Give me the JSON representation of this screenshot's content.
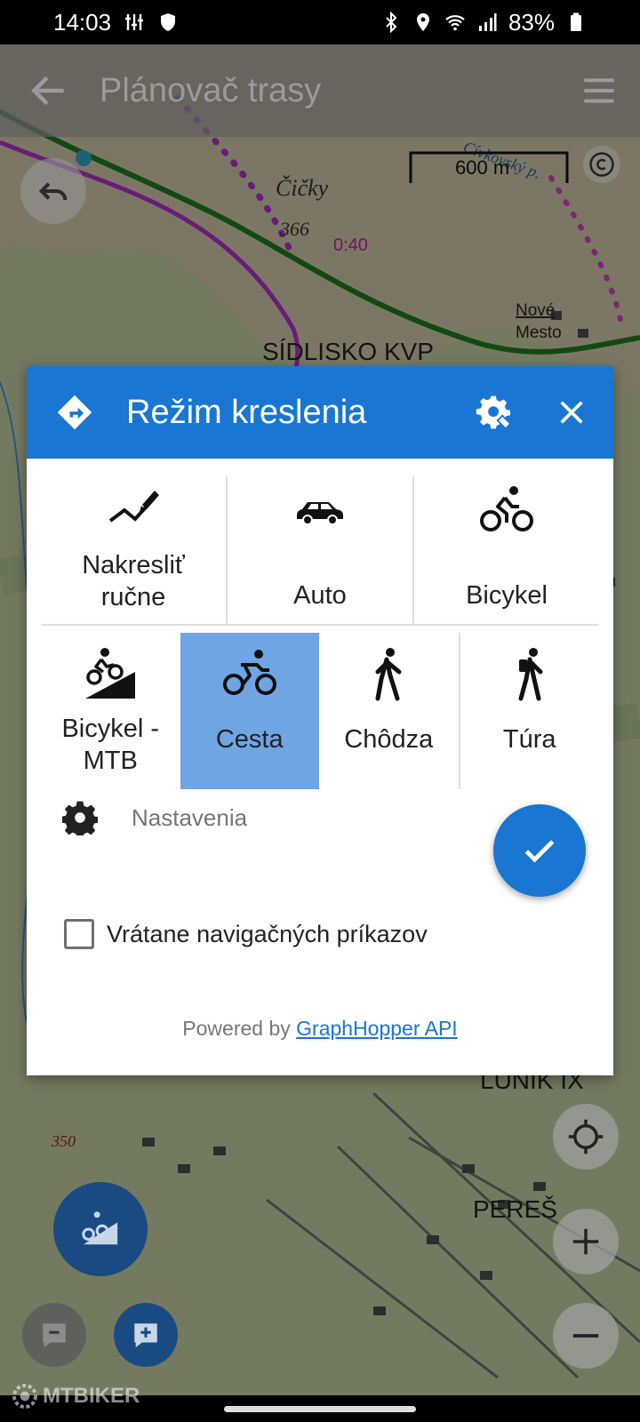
{
  "status_bar": {
    "time": "14:03",
    "battery": "83%"
  },
  "app_bar": {
    "title": "Plánovač trasy"
  },
  "map": {
    "scale_label": "600 m",
    "labels": [
      "Čičky",
      "366",
      "0:40",
      "SÍDLISKO KVP",
      "Nové",
      "Mesto",
      "LUNIK IX",
      "PEREŠ",
      "350",
      "Cívkovský p."
    ]
  },
  "dialog": {
    "title": "Režim kreslenia",
    "modes_row1": [
      {
        "id": "manual",
        "label_line1": "Nakresliť",
        "label_line2": "ručne",
        "icon": "draw-line-icon"
      },
      {
        "id": "car",
        "label_line1": "Auto",
        "label_line2": "",
        "icon": "car-icon"
      },
      {
        "id": "bike",
        "label_line1": "Bicykel",
        "label_line2": "",
        "icon": "bicycle-icon"
      }
    ],
    "modes_row2": [
      {
        "id": "mtb",
        "label_line1": "Bicykel -",
        "label_line2": "MTB",
        "icon": "mtb-icon"
      },
      {
        "id": "road",
        "label_line1": "Cesta",
        "label_line2": "",
        "icon": "road-bike-icon",
        "selected": true
      },
      {
        "id": "walk",
        "label_line1": "Chôdza",
        "label_line2": "",
        "icon": "walk-icon"
      },
      {
        "id": "hike",
        "label_line1": "Túra",
        "label_line2": "",
        "icon": "hike-icon"
      }
    ],
    "settings_label": "Nastavenia",
    "checkbox_label": "Vrátane navigačných príkazov",
    "checkbox_checked": false,
    "powered_prefix": "Powered by ",
    "powered_link": "GraphHopper API"
  },
  "watermark": "MTBIKER",
  "colors": {
    "accent": "#1976d2",
    "selected": "#6fa5e2"
  }
}
